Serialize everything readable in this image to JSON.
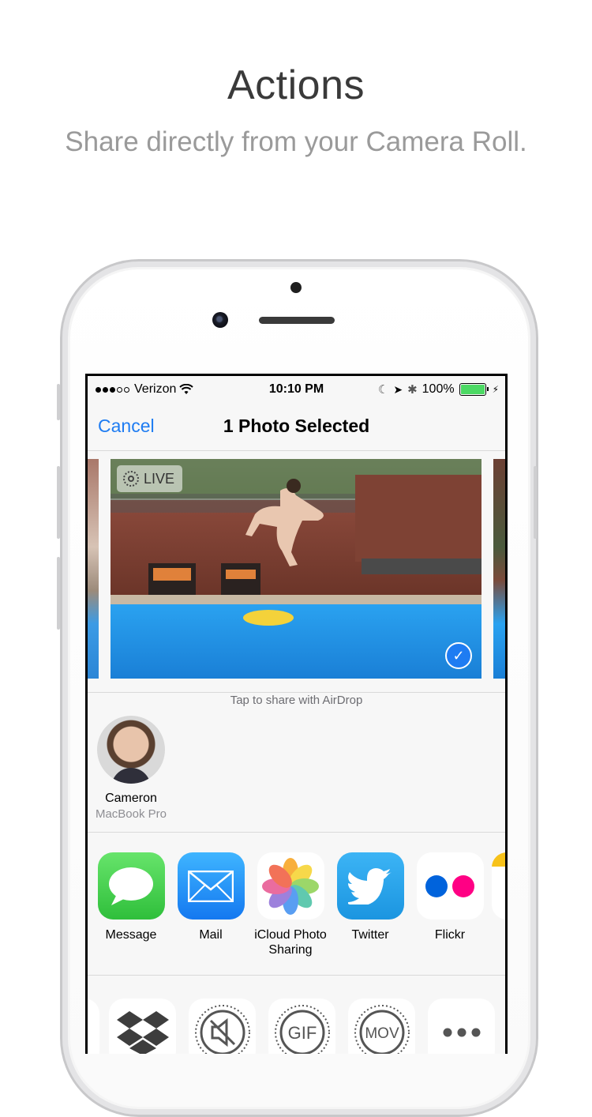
{
  "headline": "Actions",
  "subline": "Share directly from your Camera Roll.",
  "status_bar": {
    "carrier": "Verizon",
    "time": "10:10 PM",
    "battery": "100%"
  },
  "nav": {
    "cancel": "Cancel",
    "title": "1 Photo Selected"
  },
  "photo": {
    "live_badge": "LIVE"
  },
  "airdrop": {
    "hint": "Tap to share with AirDrop",
    "people": [
      {
        "name": "Cameron",
        "device": "MacBook Pro"
      }
    ]
  },
  "share_apps": [
    {
      "label": "Message",
      "icon": "message-icon"
    },
    {
      "label": "Mail",
      "icon": "mail-icon"
    },
    {
      "label": "iCloud Photo\nSharing",
      "icon": "photos-icon"
    },
    {
      "label": "Twitter",
      "icon": "twitter-icon"
    },
    {
      "label": "Flickr",
      "icon": "flickr-icon"
    }
  ],
  "actions": [
    {
      "icon": "dropbox-icon"
    },
    {
      "icon": "mute-icon"
    },
    {
      "icon": "gif-icon",
      "text": "GIF"
    },
    {
      "icon": "mov-icon",
      "text": "MOV"
    },
    {
      "icon": "more-icon"
    }
  ],
  "colors": {
    "accent": "#1e7cf2",
    "battery": "#4cd964",
    "message_green": "#4cd964",
    "mail_blue": "#1d8cf8",
    "twitter_blue": "#1da1f2",
    "flickr_blue": "#0063dc",
    "flickr_pink": "#ff0084"
  }
}
